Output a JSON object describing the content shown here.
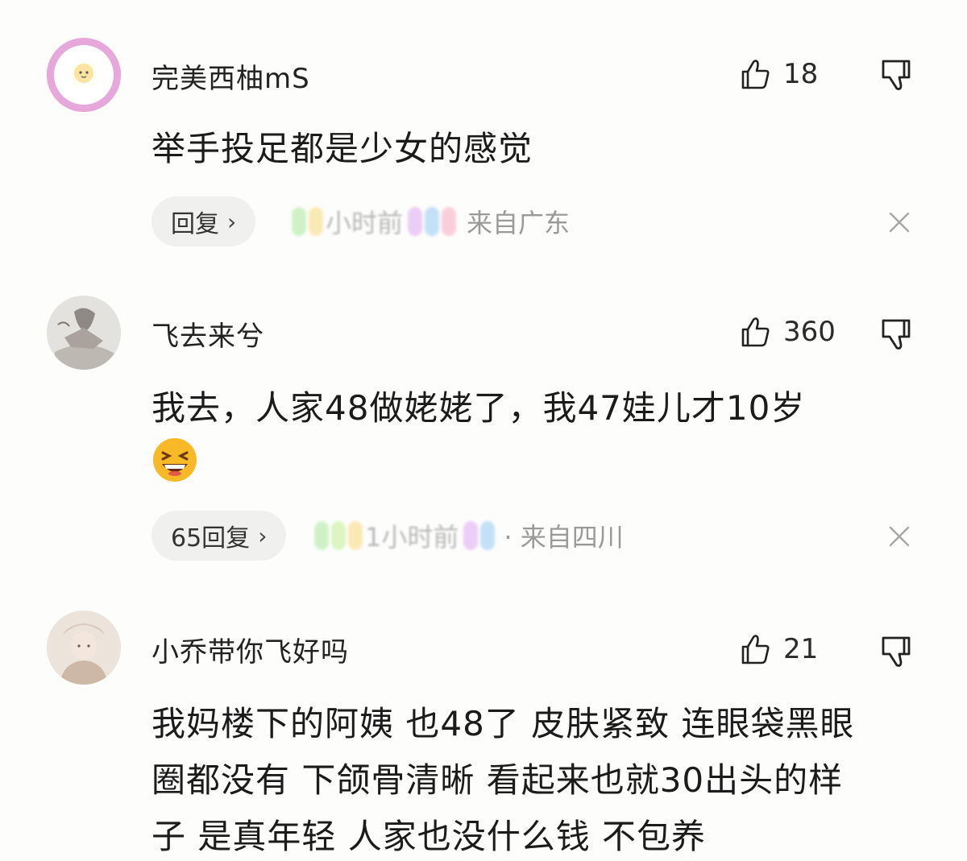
{
  "comments": [
    {
      "username": "完美西柚mS",
      "avatar_icon": "fried-egg-avatar",
      "likes": "18",
      "text": "举手投足都是少女的感觉",
      "reply_label": "回复",
      "time_blurred": "小时前",
      "location": "来自广东"
    },
    {
      "username": "飞去来兮",
      "avatar_icon": "photo-avatar",
      "likes": "360",
      "text": "我去，人家48做姥姥了，我47娃儿才10岁",
      "emoji": "laughing-emoji",
      "reply_label": "65回复",
      "time_blurred": "1小时前",
      "location": "· 来自四川"
    },
    {
      "username": "小乔带你飞好吗",
      "avatar_icon": "photo-avatar",
      "likes": "21",
      "text_lines": [
        "我妈楼下的阿姨 也48了 皮肤紧致 连眼袋黑眼",
        "圈都没有 下颌骨清晰 看起来也就30出头的样",
        "子 是真年轻 人家也没什么钱 不包养"
      ]
    }
  ],
  "colors": {
    "background": "#fdfdfc",
    "text": "#1b1b1b",
    "meta": "#9a9a9a",
    "reply_bg": "#f0f0ef",
    "avatar_ring": "#e5a6d8"
  }
}
